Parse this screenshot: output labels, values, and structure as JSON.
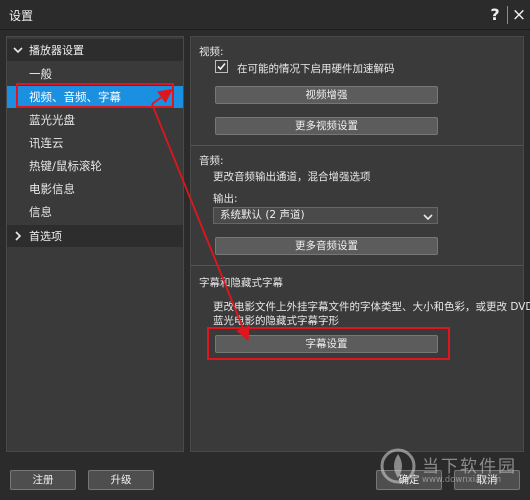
{
  "window": {
    "title": "设置",
    "help_label": "?",
    "close_label": "×"
  },
  "sidebar": {
    "groups": [
      {
        "label": "播放器设置",
        "expanded": true
      },
      {
        "label": "首选项",
        "expanded": false
      }
    ],
    "items": [
      {
        "label": "一般"
      },
      {
        "label": "视频、音频、字幕",
        "selected": true
      },
      {
        "label": "蓝光光盘"
      },
      {
        "label": "讯连云"
      },
      {
        "label": "热键/鼠标滚轮"
      },
      {
        "label": "电影信息"
      },
      {
        "label": "信息"
      }
    ]
  },
  "video": {
    "heading": "视频:",
    "hw_accel_label": "在可能的情况下启用硬件加速解码",
    "hw_accel_checked": true,
    "enhance_button": "视频增强",
    "more_button": "更多视频设置"
  },
  "audio": {
    "heading": "音频:",
    "description": "更改音频输出通道，混合增强选项",
    "output_label": "输出:",
    "output_value": "系统默认 (2 声道)",
    "more_button": "更多音频设置"
  },
  "subtitle": {
    "heading": "字幕和隐藏式字幕",
    "description_line1": "更改电影文件上外挂字幕文件的字体类型、大小和色彩，或更改 DVD 或",
    "description_line2": "蓝光电影的隐藏式字幕字形",
    "settings_button": "字幕设置"
  },
  "footer": {
    "register_button": "注册",
    "upgrade_button": "升级",
    "ok_button": "确定",
    "cancel_button": "取消"
  },
  "watermark": {
    "text": "当下软件园",
    "url": "www.downxia.com"
  },
  "colors": {
    "accent": "#1b8fe0",
    "highlight": "#e0151e",
    "background": "#2b2b2b",
    "panel": "#3a3a3a"
  }
}
